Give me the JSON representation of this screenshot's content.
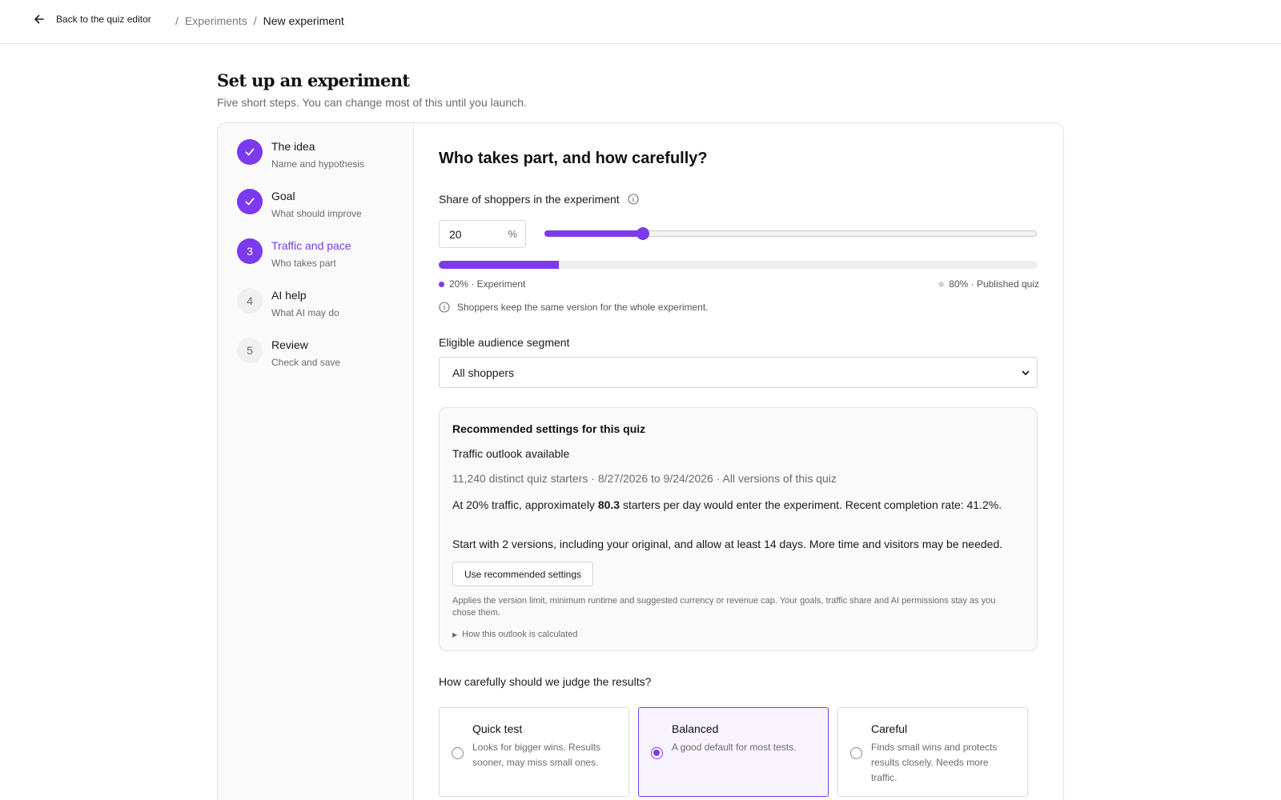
{
  "nav": {
    "back_label": "Back to the quiz editor",
    "breadcrumb_sep": "/",
    "breadcrumb_parent": "Experiments",
    "breadcrumb_current": "New experiment"
  },
  "page": {
    "title": "Set up an experiment",
    "subtitle": "Five short steps. You can change most of this until you launch."
  },
  "steps": [
    {
      "number": "1",
      "title": "The idea",
      "desc": "Name and hypothesis",
      "state": "done"
    },
    {
      "number": "2",
      "title": "Goal",
      "desc": "What should improve",
      "state": "done"
    },
    {
      "number": "3",
      "title": "Traffic and pace",
      "desc": "Who takes part",
      "state": "active"
    },
    {
      "number": "4",
      "title": "AI help",
      "desc": "What AI may do",
      "state": "todo"
    },
    {
      "number": "5",
      "title": "Review",
      "desc": "Check and save",
      "state": "todo"
    }
  ],
  "traffic": {
    "section_title": "Who takes part, and how carefully?",
    "share_label": "Share of shoppers in the experiment",
    "share_value": "20",
    "share_unit": "%",
    "share_fraction": 0.2,
    "split_left": "20% · Experiment",
    "split_right": "80% · Published quiz",
    "note": "Shoppers keep the same version for the whole experiment.",
    "colors": {
      "accent": "#7c3aed",
      "muted_dot": "#d4d4d4"
    }
  },
  "segment": {
    "label": "Eligible audience segment",
    "selected": "All shoppers"
  },
  "recommendation": {
    "title": "Recommended settings for this quiz",
    "subtitle": "Traffic outlook available",
    "stats": "11,240 distinct quiz starters · 8/27/2026 to 9/24/2026 · All versions of this quiz",
    "p1_prefix": "At 20% traffic, approximately ",
    "p1_bold": "80.3",
    "p1_suffix": " starters per day would enter the experiment. Recent completion rate: 41.2%.",
    "p2": "Start with 2 versions, including your original, and allow at least 14 days. More time and visitors may be needed.",
    "button": "Use recommended settings",
    "help": "Applies the version limit, minimum runtime and suggested currency or revenue cap. Your goals, traffic share and AI permissions stay as you chose them.",
    "details_marker": "▶",
    "details": "How this outlook is calculated"
  },
  "judging": {
    "label": "How carefully should we judge the results?",
    "options": [
      {
        "title": "Quick test",
        "desc": "Looks for bigger wins. Results sooner, may miss small ones.",
        "selected": false
      },
      {
        "title": "Balanced",
        "desc": "A good default for most tests.",
        "selected": true
      },
      {
        "title": "Careful",
        "desc": "Finds small wins and protects results closely. Needs more traffic.",
        "selected": false
      }
    ]
  },
  "icons": {
    "back": "arrow-left-icon",
    "done": "check-icon",
    "info": "info-circle-icon",
    "select": "chevron-down-icon",
    "details": "triangle-right-icon"
  }
}
